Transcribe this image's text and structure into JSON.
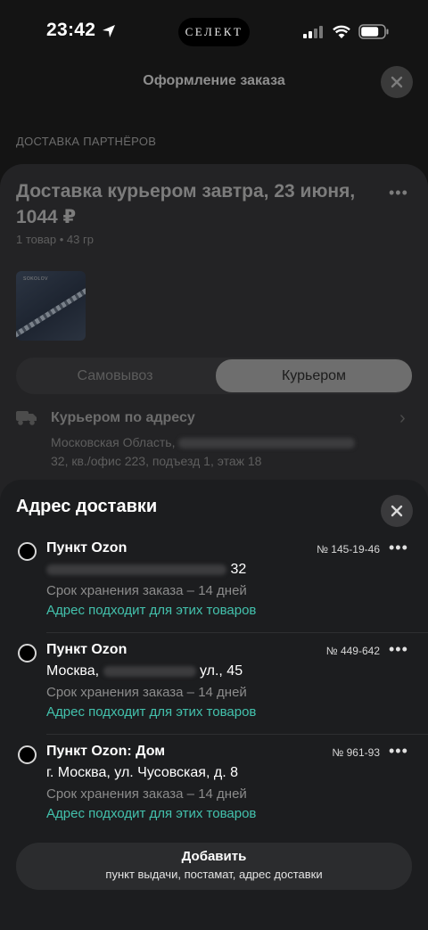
{
  "status_bar": {
    "time": "23:42",
    "island_label": "СЕЛЕКТ"
  },
  "header": {
    "title": "Оформление заказа"
  },
  "section_label": "ДОСТАВКА ПАРТНЁРОВ",
  "order": {
    "title": "Доставка курьером завтра, 23 июня, 1044 ₽",
    "meta": "1 товар • 43 гр",
    "product_brand": "SOKOLOV",
    "tabs": [
      "Самовывоз",
      "Курьером"
    ],
    "selected_tab": "Курьером",
    "courier_title": "Курьером по адресу",
    "courier_addr_start": "Московская Область,",
    "courier_addr_end": "32, кв./офис 223, подъезд 1, этаж 18"
  },
  "sheet": {
    "title": "Адрес доставки",
    "addresses": [
      {
        "name": "Пункт Ozon",
        "number": "№ 145-19-46",
        "line_prefix": "",
        "line_suffix": "32",
        "storage": "Срок хранения заказа – 14 дней",
        "status": "Адрес подходит для этих товаров"
      },
      {
        "name": "Пункт Ozon",
        "number": "№ 449-642",
        "line_prefix": "Москва,",
        "line_suffix": "ул., 45",
        "storage": "Срок хранения заказа – 14 дней",
        "status": "Адрес подходит для этих товаров"
      },
      {
        "name": "Пункт Ozon: Дом",
        "number": "№ 961-93",
        "line_prefix": "г. Москва, ул. Чусовская, д. 8",
        "line_suffix": "",
        "storage": "Срок хранения заказа – 14 дней",
        "status": "Адрес подходит для этих товаров"
      }
    ],
    "add_button": {
      "label": "Добавить",
      "sublabel": "пункт выдачи, постамат, адрес доставки"
    }
  },
  "colors": {
    "accent_green": "#43c2ad",
    "sheet_bg": "#1c1d1f",
    "page_bg": "#141414"
  }
}
